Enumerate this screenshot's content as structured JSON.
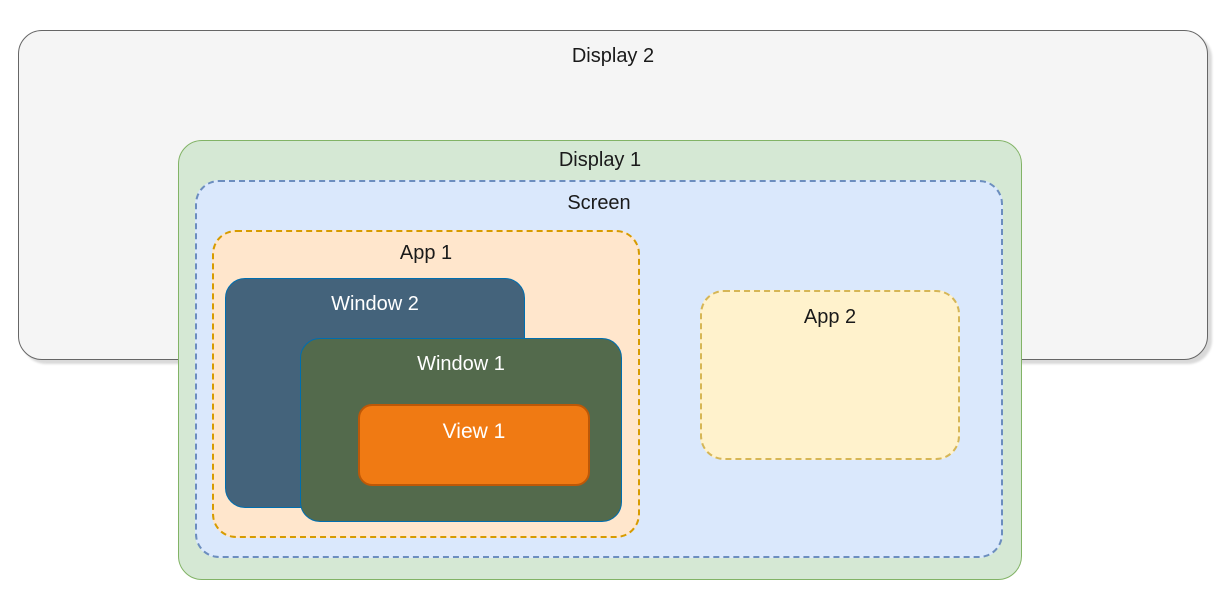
{
  "diagram": {
    "display2": {
      "label": "Display 2"
    },
    "display1": {
      "label": "Display 1"
    },
    "screen": {
      "label": "Screen"
    },
    "app1": {
      "label": "App 1"
    },
    "app2": {
      "label": "App  2"
    },
    "window2": {
      "label": "Window 2"
    },
    "window1": {
      "label": "Window 1"
    },
    "view1": {
      "label": "View 1"
    }
  }
}
